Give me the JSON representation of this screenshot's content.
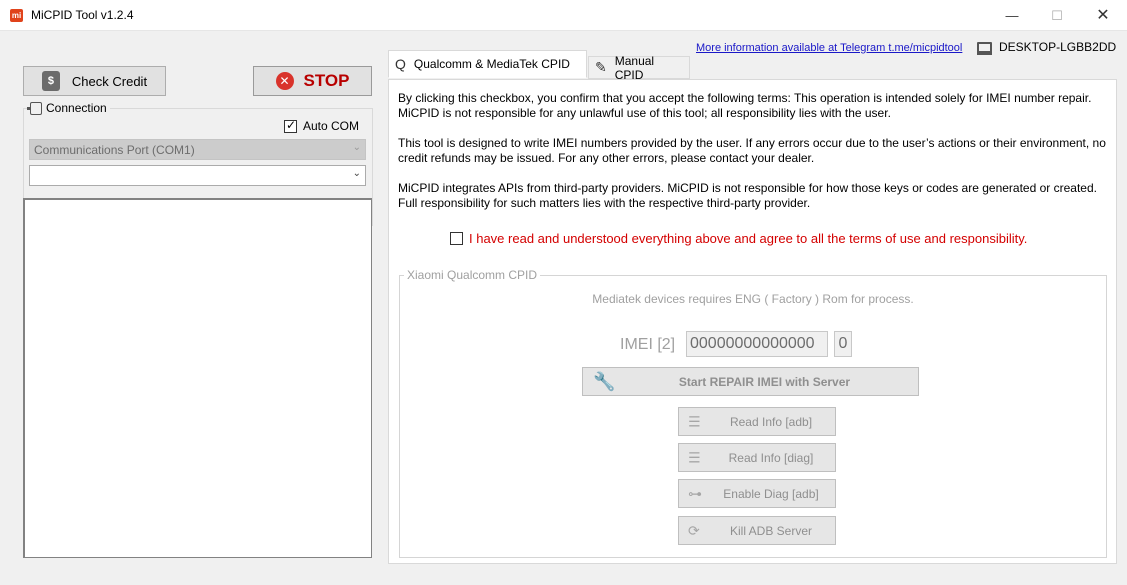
{
  "window": {
    "app_icon_text": "mi",
    "title": "MiCPID Tool v1.2.4",
    "minimize_glyph": "—",
    "maximize_glyph": "☐",
    "close_glyph": "✕"
  },
  "header": {
    "link_text": "More information available at Telegram t.me/micpidtool",
    "computer_name": "DESKTOP-LGBB2DD"
  },
  "left": {
    "check_credit_label": "Check Credit",
    "stop_label": "STOP",
    "connection_legend": "Connection",
    "auto_com_label": "Auto COM",
    "auto_com_checked": true,
    "port_combo_value": "Communications Port (COM1)",
    "second_combo_value": ""
  },
  "tabs": [
    {
      "label": "Qualcomm & MediaTek CPID",
      "icon": "qualcomm-q-icon",
      "active": true
    },
    {
      "label": "Manual CPID",
      "icon": "manual-document-icon",
      "active": false
    }
  ],
  "terms": {
    "p1": "By clicking this checkbox, you confirm that you accept the following terms: This operation is intended solely for IMEI number repair. MiCPID is not responsible for any unlawful use of this tool; all responsibility lies with the user.",
    "p2": "This tool is designed to write IMEI numbers provided by the user. If any errors occur due to the user’s actions or their environment, no credit refunds may be issued. For any other errors, please contact your dealer.",
    "p3": "MiCPID integrates APIs from third-party providers. MiCPID is not responsible for how those keys or codes are generated or created. Full responsibility for such matters lies with the respective third-party provider.",
    "agree_text": "I have read and understood everything above and agree to all the terms of use and responsibility.",
    "agree_checked": false
  },
  "cpid_group": {
    "legend": "Xiaomi Qualcomm CPID",
    "note": "Mediatek devices requires ENG ( Factory ) Rom for process.",
    "imei_label": "IMEI [2]",
    "imei_value": "00000000000000",
    "imei_count": "0",
    "repair_label": "Start REPAIR IMEI with Server",
    "read_info_adb_label": "Read Info [adb]",
    "read_info_diag_label": "Read Info [diag]",
    "enable_diag_label": "Enable Diag [adb]",
    "kill_adb_label": "Kill ADB Server"
  },
  "colors": {
    "stop_text": "#b80000",
    "agree_text": "#d40000",
    "link": "#1a18c8",
    "disabled_text": "#a0a0a0"
  }
}
